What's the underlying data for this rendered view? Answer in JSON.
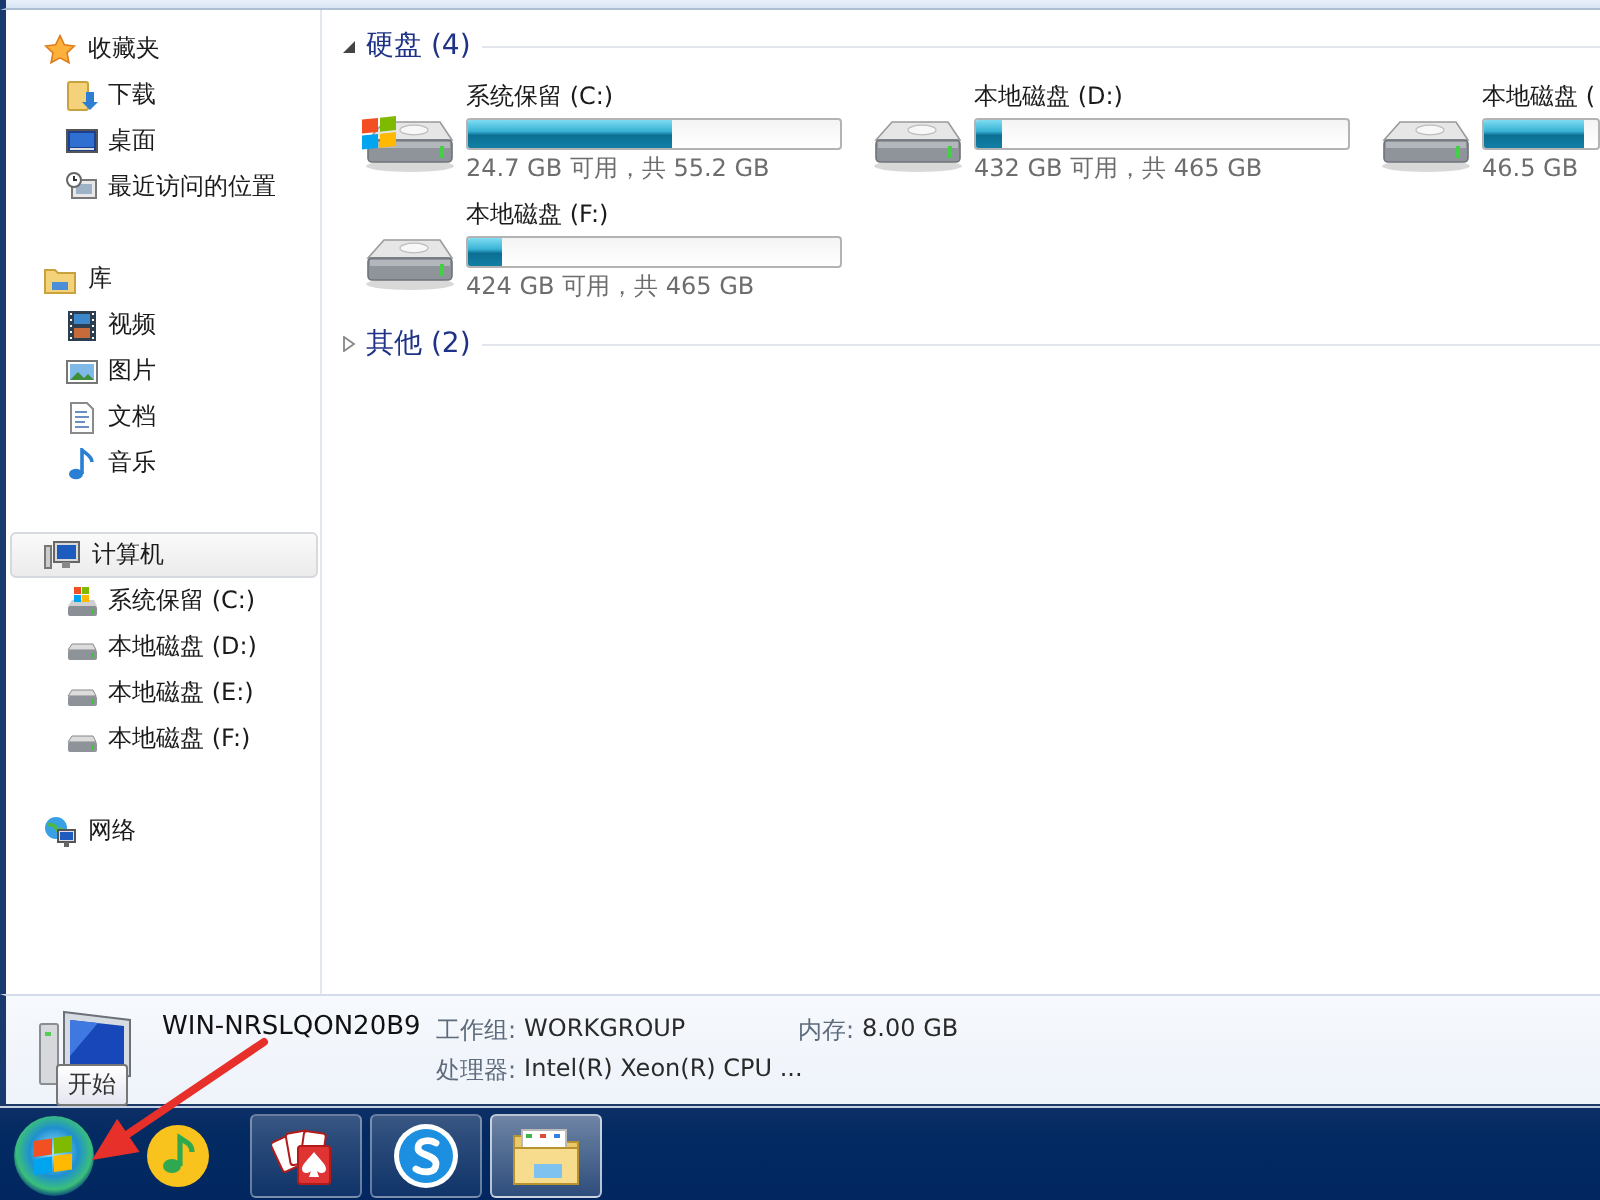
{
  "navigation": [
    {
      "label": "收藏夹",
      "kind": "favorites",
      "selected": false,
      "children": [
        {
          "label": "下载",
          "kind": "downloads",
          "selected": false
        },
        {
          "label": "桌面",
          "kind": "desktop",
          "selected": false
        },
        {
          "label": "最近访问的位置",
          "kind": "recent",
          "selected": false
        }
      ]
    },
    {
      "label": "库",
      "kind": "libraries",
      "selected": false,
      "children": [
        {
          "label": "视频",
          "kind": "videos",
          "selected": false
        },
        {
          "label": "图片",
          "kind": "pictures",
          "selected": false
        },
        {
          "label": "文档",
          "kind": "documents",
          "selected": false
        },
        {
          "label": "音乐",
          "kind": "music",
          "selected": false
        }
      ]
    },
    {
      "label": "计算机",
      "kind": "computer",
      "selected": true,
      "children": [
        {
          "label": "系统保留 (C:)",
          "kind": "system-drive",
          "selected": false
        },
        {
          "label": "本地磁盘 (D:)",
          "kind": "drive",
          "selected": false
        },
        {
          "label": "本地磁盘 (E:)",
          "kind": "drive",
          "selected": false
        },
        {
          "label": "本地磁盘 (F:)",
          "kind": "drive",
          "selected": false
        }
      ]
    },
    {
      "label": "网络",
      "kind": "network",
      "selected": false
    }
  ],
  "groups": [
    {
      "title": "硬盘 (4)",
      "expanded": true,
      "drives": [
        {
          "name": "系统保留 (C:)",
          "kind": "system",
          "level": 0.55,
          "usage": "24.7 GB 可用，共 55.2 GB"
        },
        {
          "name": "本地磁盘 (D:)",
          "kind": "local",
          "level": 0.07,
          "usage": "432 GB 可用，共 465 GB"
        },
        {
          "name": "本地磁盘 (",
          "kind": "local",
          "level": 0.88,
          "usage": "46.5 GB"
        },
        {
          "name": "本地磁盘 (F:)",
          "kind": "local",
          "level": 0.09,
          "usage": "424 GB 可用，共 465 GB"
        }
      ]
    },
    {
      "title": "其他 (2)",
      "expanded": false
    }
  ],
  "details": {
    "computer_name": "WIN-NRSLQON20B9",
    "fields": [
      {
        "label": "工作组:",
        "value": "WORKGROUP"
      },
      {
        "label": "内存:",
        "value": "8.00 GB"
      },
      {
        "label": "处理器:",
        "value": "Intel(R) Xeon(R) CPU ..."
      }
    ]
  },
  "tooltip": "开始",
  "taskbar": [
    {
      "kind": "start",
      "selected": false
    },
    {
      "kind": "music",
      "selected": false
    },
    {
      "kind": "cards",
      "selected": false
    },
    {
      "kind": "browser",
      "selected": false
    },
    {
      "kind": "folder",
      "selected": true
    }
  ]
}
